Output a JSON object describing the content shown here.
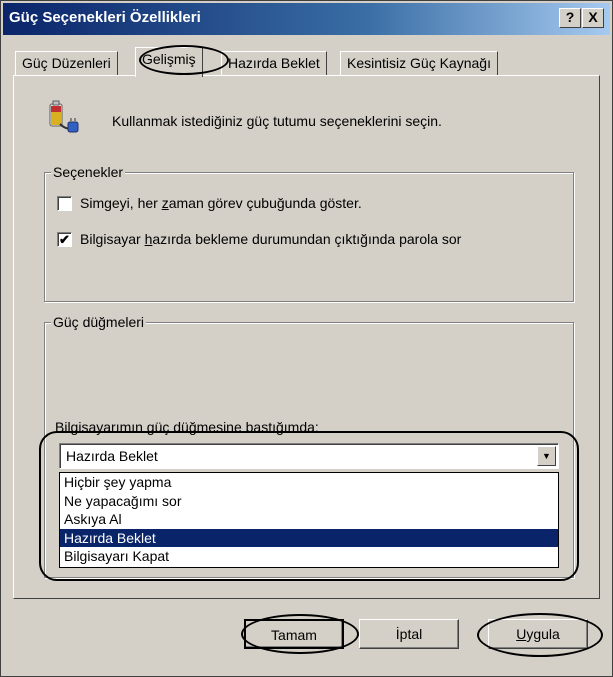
{
  "window": {
    "title": "Güç Seçenekleri Özellikleri",
    "help_button": "?",
    "close_button": "X"
  },
  "tabs": [
    {
      "label": "Güç Düzenleri"
    },
    {
      "label": "Gelişmiş"
    },
    {
      "label": "Hazırda Beklet"
    },
    {
      "label": "Kesintisiz Güç Kaynağı"
    }
  ],
  "intro_text": "Kullanmak istediğiniz güç tutumu seçeneklerini seçin.",
  "options_group": {
    "legend": "Seçenekler",
    "checkbox1": {
      "pre": "Simgeyi, her ",
      "ul": "z",
      "post": "aman görev çubuğunda göster.",
      "checked": false
    },
    "checkbox2": {
      "pre": "Bilgisayar ",
      "ul": "h",
      "post": "azırda bekleme durumundan çıktığında parola sor",
      "checked": true
    }
  },
  "power_group": {
    "legend": "Güç düğmeleri",
    "label": "Bilgisayarımın güç düğmesine bastığımda:",
    "selected": "Hazırda Beklet",
    "options": [
      "Hiçbir şey yapma",
      "Ne yapacağımı sor",
      "Askıya Al",
      "Hazırda Beklet",
      "Bilgisayarı Kapat"
    ],
    "selected_index": 3
  },
  "buttons": {
    "ok": "Tamam",
    "cancel": "İptal",
    "apply_ul": "U",
    "apply_rest": "ygula"
  },
  "colors": {
    "title_bar": "#0a246a",
    "selection": "#0a246a",
    "face": "#d4d0c8"
  }
}
